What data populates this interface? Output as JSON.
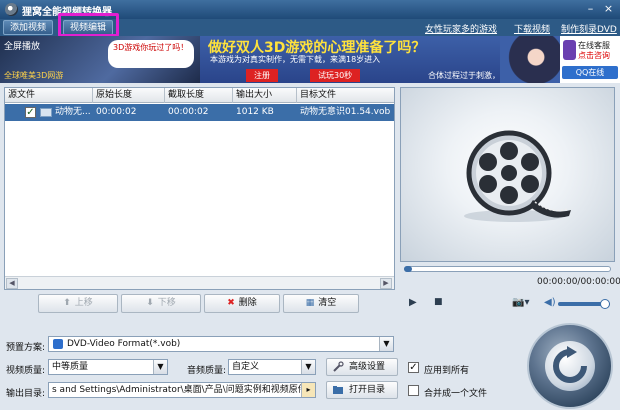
{
  "window": {
    "title": "狸窝全能视频转换器",
    "min": "–",
    "close": "×"
  },
  "toolbar": {
    "add_video": "添加视频",
    "edit_video": "视频编辑",
    "links": [
      "女性玩家多的游戏",
      "下载视频",
      "制作刻录DVD"
    ]
  },
  "banner": {
    "ad1_label": "全屏播放",
    "ad1_sub": "全球唯美3D网游",
    "ad1_bubble": "3D游戏你玩过了吗！",
    "ad2_head": "做好双人3D游戏的心理准备了吗？",
    "ad2_line": "本游戏为对真实制作，无需下载，来满18岁进入",
    "ad2_btn1": "注册",
    "ad2_btn2": "试玩30秒",
    "ad2_text3": "合体过程过于刺激，  请小心玩耍",
    "ad3_t1": "在线客服",
    "ad3_t2": "点击咨询",
    "ad3_qq": "QQ在线"
  },
  "filelist": {
    "columns": [
      "源文件",
      "原始长度",
      "截取长度",
      "输出大小",
      "目标文件"
    ],
    "rows": [
      {
        "checked": "✓",
        "source": "动物无...",
        "orig": "00:00:02",
        "cut": "00:00:02",
        "size": "1012 KB",
        "target": "动物无意识01.54.vob"
      }
    ]
  },
  "list_actions": {
    "up": "上移",
    "down": "下移",
    "delete": "删除",
    "clear": "清空"
  },
  "player": {
    "time": "00:00:00/00:00:00",
    "progress": 0,
    "volume": 1.0
  },
  "settings": {
    "preset_label": "预置方案:",
    "preset_value": "DVD-Video Format(*.vob)",
    "video_quality_label": "视频质量:",
    "video_quality_value": "中等质量",
    "audio_quality_label": "音频质量:",
    "audio_quality_value": "自定义",
    "advanced": "高级设置",
    "apply_all": "应用到所有",
    "apply_all_checked": "✓",
    "output_label": "输出目录:",
    "output_value": "s and Settings\\Administrator\\桌面\\产品\\问题实例和视频原件\\转换",
    "open_dir": "打开目录",
    "merge": "合并成一个文件"
  },
  "colors": {
    "highlight": "#e21fd0",
    "selected_row": "#3b6ea8",
    "title_bar": "#2d5a86"
  }
}
